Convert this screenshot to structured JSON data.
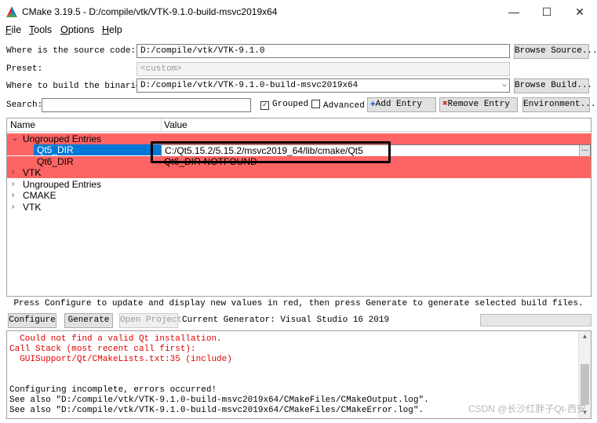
{
  "window": {
    "title": "CMake 3.19.5 - D:/compile/vtk/VTK-9.1.0-build-msvc2019x64",
    "minimize": "—",
    "maximize": "☐",
    "close": "✕"
  },
  "menu": [
    {
      "label": "File",
      "accel": "F",
      "rest": "ile"
    },
    {
      "label": "Tools",
      "accel": "T",
      "rest": "ools"
    },
    {
      "label": "Options",
      "accel": "O",
      "rest": "ptions"
    },
    {
      "label": "Help",
      "accel": "H",
      "rest": "elp"
    }
  ],
  "source": {
    "label": "Where is the source code:",
    "value": "D:/compile/vtk/VTK-9.1.0",
    "button": "Browse Source..."
  },
  "preset": {
    "label": "Preset:",
    "value": "<custom>"
  },
  "build": {
    "label": "Where to build the binaries:",
    "value": "D:/compile/vtk/VTK-9.1.0-build-msvc2019x64",
    "button": "Browse Build..."
  },
  "search": {
    "label": "Search:",
    "value": "",
    "grouped_label": "Grouped",
    "grouped_checked": true,
    "advanced_label": "Advanced",
    "advanced_checked": false,
    "add_entry": "Add Entry",
    "remove_entry": "Remove Entry",
    "environment": "Environment..."
  },
  "tree": {
    "col_name": "Name",
    "col_value": "Value",
    "group_ungrouped_red": "Ungrouped Entries",
    "entries": [
      {
        "name": "Qt5_DIR",
        "value": "C:/Qt5.15.2/5.15.2/msvc2019_64/lib/cmake/Qt5"
      },
      {
        "name": "Qt6_DIR",
        "value": "Qt6_DIR-NOTFOUND"
      }
    ],
    "group_vtk_red": "VTK",
    "groups": [
      "Ungrouped Entries",
      "CMAKE",
      "VTK"
    ],
    "edit_button": "..."
  },
  "hint": "Press Configure to update and display new values in red, then press Generate to generate selected build files.",
  "actions": {
    "configure": "Configure",
    "generate": "Generate",
    "open_project": "Open Project",
    "generator_text": "Current Generator: Visual Studio 16 2019"
  },
  "output": {
    "lines": [
      {
        "text": "  Could not find a valid Qt installation.",
        "error": true
      },
      {
        "text": "Call Stack (most recent call first):",
        "error": true
      },
      {
        "text": "  GUISupport/Qt/CMakeLists.txt:35 (include)",
        "error": true
      },
      {
        "text": "",
        "error": false
      },
      {
        "text": "",
        "error": false
      },
      {
        "text": "Configuring incomplete, errors occurred!",
        "error": false
      },
      {
        "text": "See also \"D:/compile/vtk/VTK-9.1.0-build-msvc2019x64/CMakeFiles/CMakeOutput.log\".",
        "error": false
      },
      {
        "text": "See also \"D:/compile/vtk/VTK-9.1.0-build-msvc2019x64/CMakeFiles/CMakeError.log\".",
        "error": false
      }
    ],
    "watermark": "CSDN @长沙红胖子Qt-西安"
  },
  "colors": {
    "red_row": "#ff6464",
    "selection": "#0078d7",
    "error_text": "#e00000"
  }
}
